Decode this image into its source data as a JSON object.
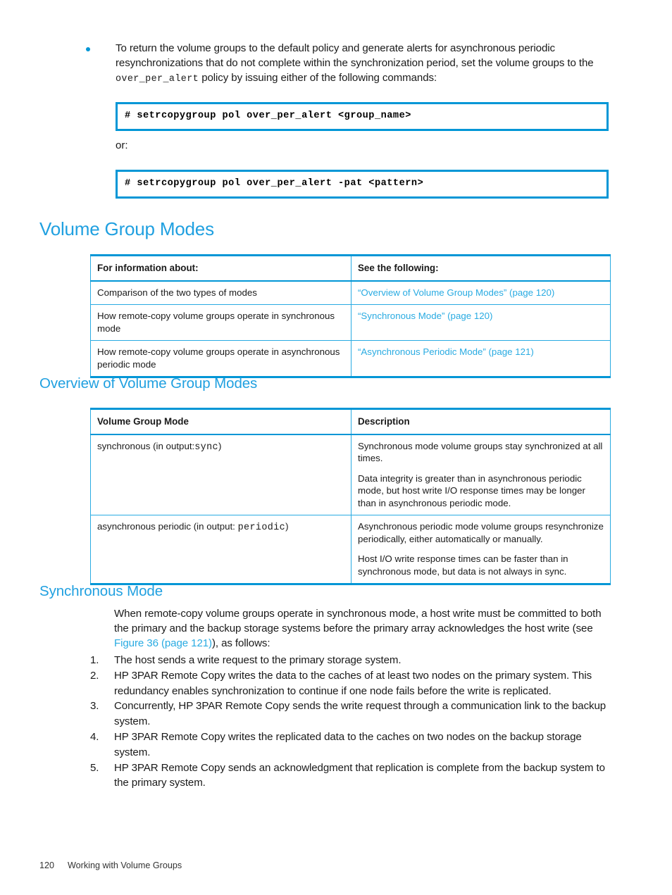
{
  "colors": {
    "accent": "#0096d6",
    "heading": "#20a0e0",
    "link": "#29abe2",
    "text": "#1a1a1a"
  },
  "bullet": {
    "text_before_code": "To return the volume groups to the default policy and generate alerts for asynchronous periodic resynchronizations that do not complete within the synchronization period, set the volume groups to the ",
    "code": "over_per_alert",
    "text_after_code": " policy by issuing either of the following commands:"
  },
  "code_blocks": [
    {
      "command": "# setrcopygroup pol over_per_alert <group_name>"
    },
    {
      "command": "# setrcopygroup pol over_per_alert -pat <pattern>"
    }
  ],
  "or_label": "or:",
  "headings": {
    "volume_group_modes": "Volume Group Modes",
    "overview_of_volume_group_modes": "Overview of Volume Group Modes",
    "synchronous_mode": "Synchronous Mode"
  },
  "table_info": {
    "headers": [
      "For information about:",
      "See the following:"
    ],
    "rows": [
      {
        "info": "Comparison of the two types of modes",
        "link": "“Overview of Volume Group Modes” (page 120)"
      },
      {
        "info": "How remote-copy volume groups operate in synchronous mode",
        "link": "“Synchronous Mode” (page 120)"
      },
      {
        "info": "How remote-copy volume groups operate in asynchronous periodic mode",
        "link": "“Asynchronous Periodic Mode” (page 121)"
      }
    ]
  },
  "table_modes": {
    "headers": [
      "Volume Group Mode",
      "Description"
    ],
    "rows": [
      {
        "mode_prefix": "synchronous (in output:",
        "mode_code": "sync",
        "mode_suffix": ")",
        "desc_1": "Synchronous mode volume groups stay synchronized at all times.",
        "desc_2": "Data integrity is greater than in asynchronous periodic mode, but host write I/O response times may be longer than in asynchronous periodic mode."
      },
      {
        "mode_prefix": "asynchronous periodic (in output: ",
        "mode_code": "periodic",
        "mode_suffix": ")",
        "desc_1": "Asynchronous periodic mode volume groups resynchronize periodically, either automatically or manually.",
        "desc_2": "Host I/O write response times can be faster than in synchronous mode, but data is not always in sync."
      }
    ]
  },
  "sync_section": {
    "intro_part1": "When remote-copy volume groups operate in synchronous mode, a host write must be committed to both the primary and the backup storage systems before the primary array acknowledges the host write (see ",
    "intro_link": "Figure 36 (page 121)",
    "intro_part2": "), as follows:",
    "steps": [
      {
        "num": "1.",
        "text": "The host sends a write request to the primary storage system."
      },
      {
        "num": "2.",
        "text": "HP 3PAR Remote Copy writes the data to the caches of at least two nodes on the primary system. This redundancy enables synchronization to continue if one node fails before the write is replicated."
      },
      {
        "num": "3.",
        "text": "Concurrently, HP 3PAR Remote Copy sends the write request through a communication link to the backup system."
      },
      {
        "num": "4.",
        "text": "HP 3PAR Remote Copy writes the replicated data to the caches on two nodes on the backup storage system."
      },
      {
        "num": "5.",
        "text": "HP 3PAR Remote Copy sends an acknowledgment that replication is complete from the backup system to the primary system."
      }
    ]
  },
  "footer": {
    "page_number": "120",
    "chapter_title": "Working with Volume Groups"
  }
}
